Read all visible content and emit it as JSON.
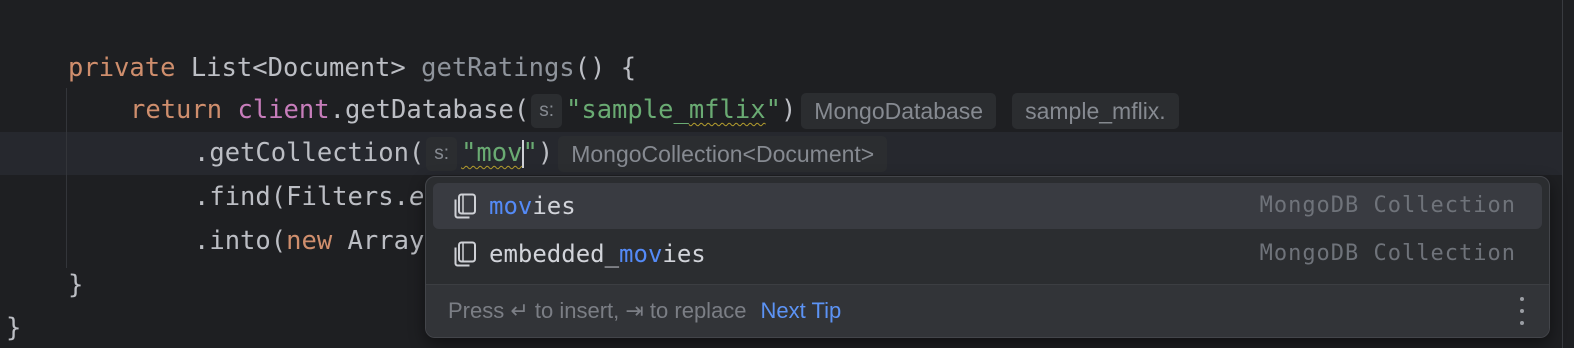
{
  "code": {
    "line1": {
      "kw_private": "private",
      "type": "List<Document>",
      "method": "getRatings",
      "tail": "() {"
    },
    "line2": {
      "kw_return": "return",
      "field": "client",
      "call": ".getDatabase(",
      "param_hint": "s:",
      "arg": "\"sample_mflix\"",
      "close": ")",
      "type_hint": "MongoDatabase",
      "value_hint": "sample_mflix."
    },
    "line3": {
      "call": ".getCollection(",
      "param_hint": "s:",
      "arg_before_caret": "\"mov",
      "arg_after_caret": "\"",
      "close": ")",
      "type_hint": "MongoCollection<Document>"
    },
    "line4": {
      "prefix": ".find(Filters.",
      "italic": "e"
    },
    "line5": {
      "prefix": ".into(",
      "kw_new": "new",
      "rest": " Array"
    },
    "line6": "}",
    "line7": "}"
  },
  "completion": {
    "items": [
      {
        "match": "mov",
        "rest": "ies",
        "type": "MongoDB Collection",
        "icon": "collection-icon",
        "selected": true
      },
      {
        "before": "embedded_",
        "match": "mov",
        "rest": "ies",
        "type": "MongoDB Collection",
        "icon": "collection-icon",
        "selected": false
      }
    ],
    "footer": {
      "text": "Press ↵ to insert, ⇥ to replace",
      "next_tip": "Next Tip",
      "more_icon": "more-vertical-icon"
    }
  },
  "colors": {
    "background": "#1e1f22",
    "keyword": "#cf8e6d",
    "string": "#6aab73",
    "field": "#c77dbb",
    "match_highlight": "#548af7",
    "link": "#5c93f5"
  }
}
